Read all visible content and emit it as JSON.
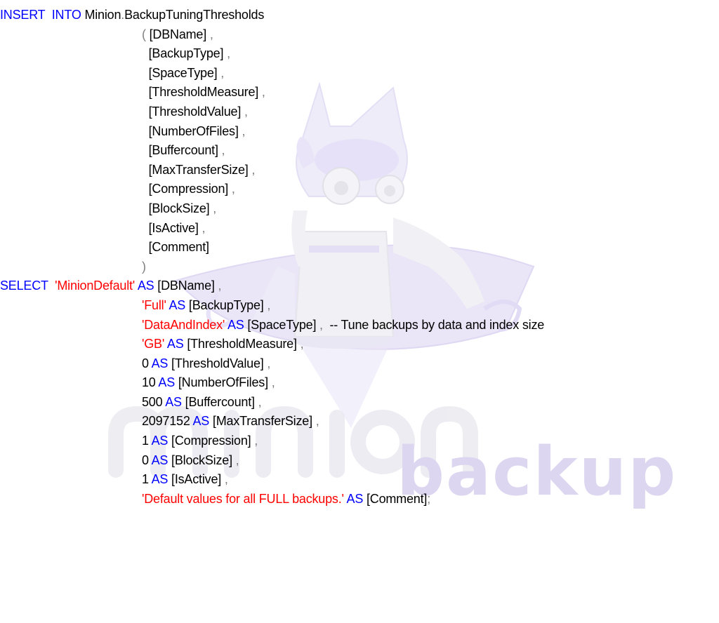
{
  "colors": {
    "keyword": "#0000ff",
    "string": "#ff0000",
    "operator": "#808080",
    "text": "#000000",
    "watermark": "#ddd6f0"
  },
  "watermark": {
    "brand_text": "backup",
    "mascot": "robot-mascot-icon"
  },
  "code_lines": [
    {
      "name": "insert-into-line",
      "indent": 0,
      "tokens": [
        {
          "t": "INSERT  INTO",
          "c": "kw"
        },
        {
          "t": " Minion",
          "c": "plain"
        },
        {
          "t": ".",
          "c": "op"
        },
        {
          "t": "BackupTuningThresholds",
          "c": "plain"
        }
      ]
    },
    {
      "name": "column-dbname-line",
      "indent": 1,
      "tokens": [
        {
          "t": "( ",
          "c": "op"
        },
        {
          "t": "[DBName]",
          "c": "plain"
        },
        {
          "t": " ,",
          "c": "op"
        }
      ]
    },
    {
      "name": "column-backuptype-line",
      "indent": 1,
      "tokens": [
        {
          "t": "  ",
          "c": "plain"
        },
        {
          "t": "[BackupType]",
          "c": "plain"
        },
        {
          "t": " ,",
          "c": "op"
        }
      ]
    },
    {
      "name": "column-spacetype-line",
      "indent": 1,
      "tokens": [
        {
          "t": "  ",
          "c": "plain"
        },
        {
          "t": "[SpaceType]",
          "c": "plain"
        },
        {
          "t": " ,",
          "c": "op"
        }
      ]
    },
    {
      "name": "column-thresholdmeasure-line",
      "indent": 1,
      "tokens": [
        {
          "t": "  ",
          "c": "plain"
        },
        {
          "t": "[ThresholdMeasure]",
          "c": "plain"
        },
        {
          "t": " ,",
          "c": "op"
        }
      ]
    },
    {
      "name": "column-thresholdvalue-line",
      "indent": 1,
      "tokens": [
        {
          "t": "  ",
          "c": "plain"
        },
        {
          "t": "[ThresholdValue]",
          "c": "plain"
        },
        {
          "t": " ,",
          "c": "op"
        }
      ]
    },
    {
      "name": "column-numberoffiles-line",
      "indent": 1,
      "tokens": [
        {
          "t": "  ",
          "c": "plain"
        },
        {
          "t": "[NumberOfFiles]",
          "c": "plain"
        },
        {
          "t": " ,",
          "c": "op"
        }
      ]
    },
    {
      "name": "column-buffercount-line",
      "indent": 1,
      "tokens": [
        {
          "t": "  ",
          "c": "plain"
        },
        {
          "t": "[Buffercount]",
          "c": "plain"
        },
        {
          "t": " ,",
          "c": "op"
        }
      ]
    },
    {
      "name": "column-maxtransfersize-line",
      "indent": 1,
      "tokens": [
        {
          "t": "  ",
          "c": "plain"
        },
        {
          "t": "[MaxTransferSize]",
          "c": "plain"
        },
        {
          "t": " ,",
          "c": "op"
        }
      ]
    },
    {
      "name": "column-compression-line",
      "indent": 1,
      "tokens": [
        {
          "t": "  ",
          "c": "plain"
        },
        {
          "t": "[Compression]",
          "c": "plain"
        },
        {
          "t": " ,",
          "c": "op"
        }
      ]
    },
    {
      "name": "column-blocksize-line",
      "indent": 1,
      "tokens": [
        {
          "t": "  ",
          "c": "plain"
        },
        {
          "t": "[BlockSize]",
          "c": "plain"
        },
        {
          "t": " ,",
          "c": "op"
        }
      ]
    },
    {
      "name": "column-isactive-line",
      "indent": 1,
      "tokens": [
        {
          "t": "  ",
          "c": "plain"
        },
        {
          "t": "[IsActive]",
          "c": "plain"
        },
        {
          "t": " ,",
          "c": "op"
        }
      ]
    },
    {
      "name": "column-comment-line",
      "indent": 1,
      "tokens": [
        {
          "t": "  ",
          "c": "plain"
        },
        {
          "t": "[Comment]",
          "c": "plain"
        }
      ]
    },
    {
      "name": "close-paren-line",
      "indent": 1,
      "tokens": [
        {
          "t": ")",
          "c": "op"
        }
      ]
    },
    {
      "name": "select-line",
      "indent": 0,
      "tokens": [
        {
          "t": "SELECT",
          "c": "kw"
        },
        {
          "t": "  ",
          "c": "plain"
        },
        {
          "t": "'MinionDefault'",
          "c": "str"
        },
        {
          "t": " AS",
          "c": "kw"
        },
        {
          "t": " [DBName]",
          "c": "plain"
        },
        {
          "t": " ,",
          "c": "op"
        }
      ]
    },
    {
      "name": "value-backuptype-line",
      "indent": 2,
      "tokens": [
        {
          "t": "'Full'",
          "c": "str"
        },
        {
          "t": " AS",
          "c": "kw"
        },
        {
          "t": " [BackupType]",
          "c": "plain"
        },
        {
          "t": " ,",
          "c": "op"
        }
      ]
    },
    {
      "name": "value-spacetype-line",
      "indent": 2,
      "tokens": [
        {
          "t": "'DataAndIndex'",
          "c": "str"
        },
        {
          "t": " AS",
          "c": "kw"
        },
        {
          "t": " [SpaceType]",
          "c": "plain"
        },
        {
          "t": " ,",
          "c": "op"
        },
        {
          "t": "  -- Tune backups by data and index size",
          "c": "comment"
        }
      ]
    },
    {
      "name": "value-thresholdmeasure-line",
      "indent": 2,
      "tokens": [
        {
          "t": "'GB'",
          "c": "str"
        },
        {
          "t": " AS",
          "c": "kw"
        },
        {
          "t": " [ThresholdMeasure]",
          "c": "plain"
        },
        {
          "t": " ,",
          "c": "op"
        }
      ]
    },
    {
      "name": "value-thresholdvalue-line",
      "indent": 2,
      "tokens": [
        {
          "t": "0",
          "c": "plain"
        },
        {
          "t": " AS",
          "c": "kw"
        },
        {
          "t": " [ThresholdValue]",
          "c": "plain"
        },
        {
          "t": " ,",
          "c": "op"
        }
      ]
    },
    {
      "name": "value-numberoffiles-line",
      "indent": 2,
      "tokens": [
        {
          "t": "10",
          "c": "plain"
        },
        {
          "t": " AS",
          "c": "kw"
        },
        {
          "t": " [NumberOfFiles]",
          "c": "plain"
        },
        {
          "t": " ,",
          "c": "op"
        }
      ]
    },
    {
      "name": "value-buffercount-line",
      "indent": 2,
      "tokens": [
        {
          "t": "500",
          "c": "plain"
        },
        {
          "t": " AS",
          "c": "kw"
        },
        {
          "t": " [Buffercount]",
          "c": "plain"
        },
        {
          "t": " ,",
          "c": "op"
        }
      ]
    },
    {
      "name": "value-maxtransfersize-line",
      "indent": 2,
      "tokens": [
        {
          "t": "2097152",
          "c": "plain"
        },
        {
          "t": " AS",
          "c": "kw"
        },
        {
          "t": " [MaxTransferSize]",
          "c": "plain"
        },
        {
          "t": " ,",
          "c": "op"
        }
      ]
    },
    {
      "name": "value-compression-line",
      "indent": 2,
      "tokens": [
        {
          "t": "1",
          "c": "plain"
        },
        {
          "t": " AS",
          "c": "kw"
        },
        {
          "t": " [Compression]",
          "c": "plain"
        },
        {
          "t": " ,",
          "c": "op"
        }
      ]
    },
    {
      "name": "value-blocksize-line",
      "indent": 2,
      "tokens": [
        {
          "t": "0",
          "c": "plain"
        },
        {
          "t": " AS",
          "c": "kw"
        },
        {
          "t": " [BlockSize]",
          "c": "plain"
        },
        {
          "t": " ,",
          "c": "op"
        }
      ]
    },
    {
      "name": "value-isactive-line",
      "indent": 2,
      "tokens": [
        {
          "t": "1",
          "c": "plain"
        },
        {
          "t": " AS",
          "c": "kw"
        },
        {
          "t": " [IsActive]",
          "c": "plain"
        },
        {
          "t": " ,",
          "c": "op"
        }
      ]
    },
    {
      "name": "value-comment-line",
      "indent": 2,
      "tokens": [
        {
          "t": "'Default values for all FULL backups.'",
          "c": "str"
        },
        {
          "t": " AS",
          "c": "kw"
        },
        {
          "t": " [Comment]",
          "c": "plain"
        },
        {
          "t": ";",
          "c": "op"
        }
      ]
    }
  ]
}
